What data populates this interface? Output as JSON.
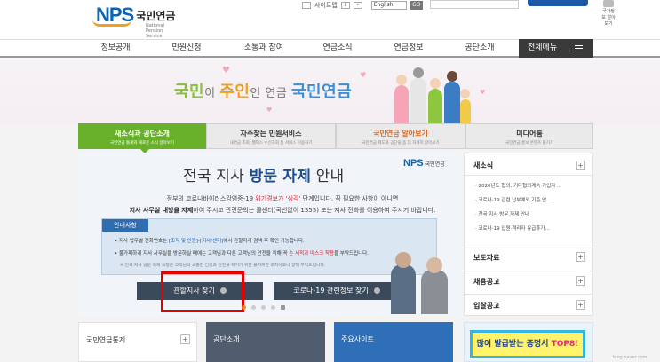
{
  "header": {
    "logo_main": "NPS",
    "logo_kr": "국민연금",
    "logo_en": "National Pension Service",
    "sitemap": "사이트맵",
    "lang_select": "English",
    "go": "GO",
    "side_icon_label": "국가정보 알아보기"
  },
  "gnb": {
    "items": [
      "정보공개",
      "민원신청",
      "소통과 참여",
      "연금소식",
      "연금정보",
      "공단소개"
    ],
    "all_menu": "전체메뉴"
  },
  "hero": {
    "slogan_1": "국민",
    "slogan_2": "이 ",
    "slogan_3": "주인",
    "slogan_4": "인 연금 ",
    "slogan_5": "국민연금"
  },
  "tabs": [
    {
      "title": "새소식과 공단소개",
      "sub": "국민연금 통계와 새로운 소식 알아보기"
    },
    {
      "title": "자주찾는 민원서비스",
      "sub": "내연금 조회, 웹팩스 수신조회 등 서비스 이용하기"
    },
    {
      "title": "국민연금 알아보기",
      "sub": "국민연금 제도와 공단을 좀 더 자세히 알아보기"
    },
    {
      "title": "미디어룸",
      "sub": "국민연금 홍보 콘텐츠 즐기기"
    }
  ],
  "notice": {
    "logo_n": "NPS",
    "logo_k": "국민연금",
    "title_1": "전국 지사 ",
    "title_2": "방문 자제",
    "title_3": " 안내",
    "body_1a": "정부의 코로나바이러스감염증-19 ",
    "body_1b": "위기경보가 '심각'",
    "body_1c": " 단계입니다. 꼭 필요한 사항이 아니면",
    "body_2a": "지사 사무실 내방을 자제",
    "body_2b": "하여 주시고 관련문의는 콜센터(국번없이 1355) 또는 지사 전화를 이용하여 주시기 바랍니다.",
    "guide_label": "안내사항",
    "guide_1a": "• 지사 업무별 전화번호는 ",
    "guide_1b": "[조직 및 인원]-[지사/센터]",
    "guide_1c": "에서 관할지사 검색 후 확인 가능합니다.",
    "guide_2a": "• 불가피하게 지사 사무실을 방문하실 때에는 고객님과 다른 고객님의 안전을 위해 꼭 ",
    "guide_2b": "손 세척과 마스크 착용",
    "guide_2c": "을 부탁드립니다.",
    "guide_3": "※ 전국 지사 방문 자제 요청은 고객님의 소중한 건강과 안전을 지키기 위한 불가피한 조치이오니 양해 부탁드립니다.",
    "cta_1": "관할지사 찾기",
    "cta_2": "코로나-19 관련정보 찾기"
  },
  "side": {
    "news_title": "새소식",
    "news": [
      "2020년도 협의, 기타협의계속 가입자 ...",
      "코로나-19 관련 납부예외 기준 안...",
      "전국 지사 방문 자제 안내",
      "코로나-19 입원·격리자 유급휴가..."
    ],
    "sections": [
      "보도자료",
      "채용공고",
      "입찰공고"
    ]
  },
  "bottom": {
    "stats": "국민연금통계",
    "about": "공단소개",
    "sites": "주요사이트",
    "banner_a": "많이 발급받는 증명서 ",
    "banner_b": "TOP8!"
  },
  "plus": "+",
  "watermark": "blog.naver.com"
}
